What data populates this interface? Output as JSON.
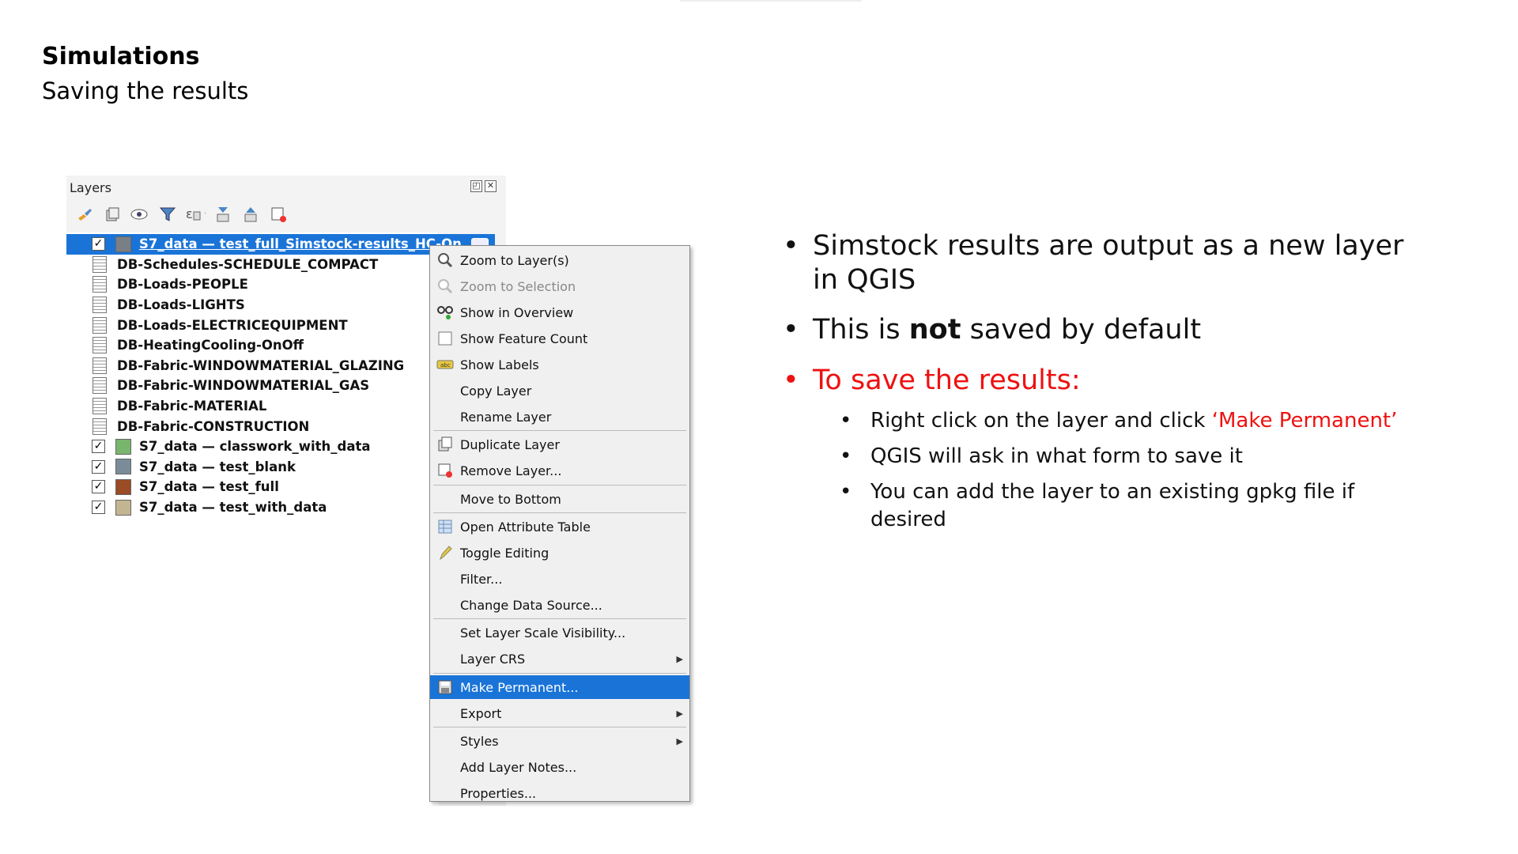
{
  "slide": {
    "title": "Simulations",
    "subtitle": "Saving the results"
  },
  "layers_panel": {
    "title": "Layers",
    "toolbar_icons": [
      "paint-brush-icon",
      "add-group-icon",
      "eye-icon",
      "filter-icon",
      "filter-expression-icon",
      "expand-all-icon",
      "collapse-all-icon",
      "remove-layer-icon"
    ],
    "layers": [
      {
        "name": "S7_data — test_full_Simstock-results_HC-On",
        "type": "vector",
        "checked": true,
        "selected": true,
        "color": "#7a7f86"
      },
      {
        "name": "DB-Schedules-SCHEDULE_COMPACT",
        "type": "table"
      },
      {
        "name": "DB-Loads-PEOPLE",
        "type": "table"
      },
      {
        "name": "DB-Loads-LIGHTS",
        "type": "table"
      },
      {
        "name": "DB-Loads-ELECTRICEQUIPMENT",
        "type": "table"
      },
      {
        "name": "DB-HeatingCooling-OnOff",
        "type": "table"
      },
      {
        "name": "DB-Fabric-WINDOWMATERIAL_GLAZING",
        "type": "table"
      },
      {
        "name": "DB-Fabric-WINDOWMATERIAL_GAS",
        "type": "table"
      },
      {
        "name": "DB-Fabric-MATERIAL",
        "type": "table"
      },
      {
        "name": "DB-Fabric-CONSTRUCTION",
        "type": "table"
      },
      {
        "name": "S7_data — classwork_with_data",
        "type": "vector",
        "checked": true,
        "color": "#79b66d"
      },
      {
        "name": "S7_data — test_blank",
        "type": "vector",
        "checked": true,
        "color": "#7a8c99"
      },
      {
        "name": "S7_data — test_full",
        "type": "vector",
        "checked": true,
        "color": "#9b4b26"
      },
      {
        "name": "S7_data — test_with_data",
        "type": "vector",
        "checked": true,
        "color": "#c4b592"
      }
    ]
  },
  "context_menu": {
    "items": [
      {
        "label": "Zoom to Layer(s)",
        "icon": "zoom-layer-icon"
      },
      {
        "label": "Zoom to Selection",
        "icon": "zoom-selection-icon",
        "disabled": true
      },
      {
        "label": "Show in Overview",
        "icon": "overview-icon"
      },
      {
        "label": "Show Feature Count",
        "icon": "checkbox-icon"
      },
      {
        "label": "Show Labels",
        "icon": "labels-icon"
      },
      {
        "label": "Copy Layer",
        "icon": ""
      },
      {
        "label": "Rename Layer",
        "icon": ""
      },
      {
        "label": "Duplicate Layer",
        "icon": "duplicate-icon"
      },
      {
        "label": "Remove Layer...",
        "icon": "remove-icon"
      },
      {
        "label": "Move to Bottom",
        "icon": ""
      },
      {
        "label": "Open Attribute Table",
        "icon": "attribute-table-icon"
      },
      {
        "label": "Toggle Editing",
        "icon": "pencil-icon"
      },
      {
        "label": "Filter...",
        "icon": ""
      },
      {
        "label": "Change Data Source...",
        "icon": ""
      },
      {
        "label": "Set Layer Scale Visibility...",
        "icon": ""
      },
      {
        "label": "Layer CRS",
        "icon": "",
        "submenu": true
      },
      {
        "label": "Make Permanent...",
        "icon": "save-icon",
        "highlighted": true
      },
      {
        "label": "Export",
        "icon": "",
        "submenu": true
      },
      {
        "label": "Styles",
        "icon": "",
        "submenu": true
      },
      {
        "label": "Add Layer Notes...",
        "icon": ""
      },
      {
        "label": "Properties...",
        "icon": ""
      }
    ]
  },
  "bullets": {
    "b1": "Simstock results are output as a new layer in QGIS",
    "b2_pre": "This is ",
    "b2_bold": "not",
    "b2_post": " saved by default",
    "b3": "To save the results:",
    "s1_pre": "Right click on the layer and click ",
    "s1_red": "‘Make Permanent’",
    "s2": "QGIS will ask in what form to save it",
    "s3": "You can add the layer to an existing gpkg file if desired",
    "colors": {
      "text": "#111111",
      "highlight_red": "#ee1111"
    }
  }
}
